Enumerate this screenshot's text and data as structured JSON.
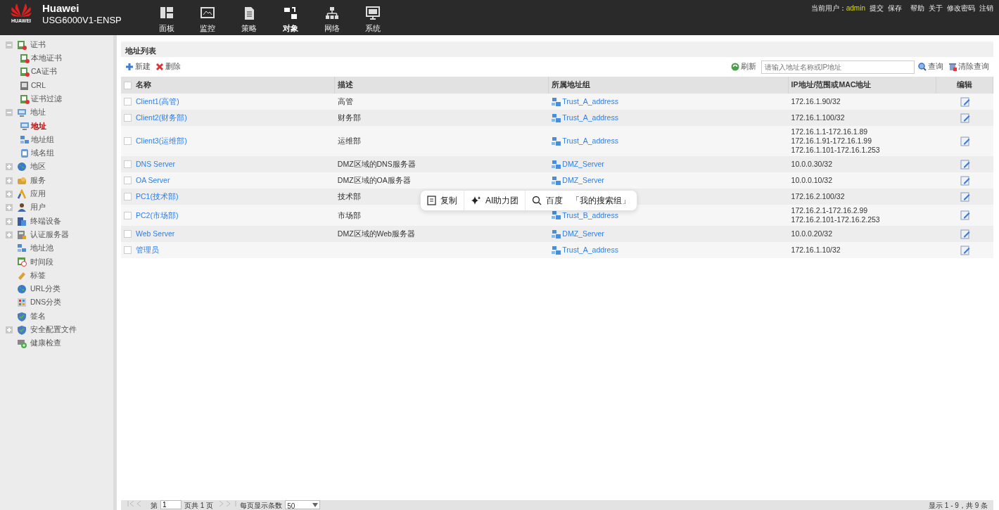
{
  "header": {
    "brand": "HUAWEI",
    "title": "Huawei",
    "model": "USG6000V1-ENSP",
    "current_user_label": "当前用户：",
    "user": "admin",
    "links": [
      "提交",
      "保存",
      "帮助",
      "关于",
      "修改密码",
      "注销"
    ]
  },
  "nav": [
    {
      "label": "面板",
      "selected": false
    },
    {
      "label": "监控",
      "selected": false
    },
    {
      "label": "策略",
      "selected": false
    },
    {
      "label": "对象",
      "selected": true
    },
    {
      "label": "网络",
      "selected": false
    },
    {
      "label": "系统",
      "selected": false
    }
  ],
  "sidebar": {
    "items": [
      {
        "label": "证书",
        "expanded": true,
        "selected": false,
        "children": [
          {
            "label": "本地证书",
            "selected": false
          },
          {
            "label": "CA证书",
            "selected": false
          },
          {
            "label": "CRL",
            "selected": false
          },
          {
            "label": "证书过滤",
            "selected": false
          }
        ]
      },
      {
        "label": "地址",
        "expanded": true,
        "selected": false,
        "children": [
          {
            "label": "地址",
            "selected": true
          },
          {
            "label": "地址组",
            "selected": false
          },
          {
            "label": "域名组",
            "selected": false
          }
        ]
      },
      {
        "label": "地区",
        "expanded": false,
        "selected": false
      },
      {
        "label": "服务",
        "expanded": false,
        "selected": false
      },
      {
        "label": "应用",
        "expanded": false,
        "selected": false
      },
      {
        "label": "用户",
        "expanded": false,
        "selected": false
      },
      {
        "label": "终端设备",
        "expanded": false,
        "selected": false
      },
      {
        "label": "认证服务器",
        "expanded": false,
        "selected": false
      },
      {
        "label": "地址池",
        "selected": false
      },
      {
        "label": "时间段",
        "selected": false
      },
      {
        "label": "标签",
        "selected": false
      },
      {
        "label": "URL分类",
        "selected": false
      },
      {
        "label": "DNS分类",
        "selected": false
      },
      {
        "label": "签名",
        "selected": false
      },
      {
        "label": "安全配置文件",
        "expanded": false,
        "selected": false
      },
      {
        "label": "健康检查",
        "selected": false
      }
    ]
  },
  "panel": {
    "title": "地址列表",
    "toolbar": {
      "new": "新建",
      "delete": "删除",
      "refresh": "刷新",
      "search": {
        "placeholder": "请输入地址名称或IP地址"
      },
      "query": "查询",
      "clear": "清除查询"
    }
  },
  "table": {
    "columns": [
      "名称",
      "描述",
      "所属地址组",
      "IP地址/范围或MAC地址",
      "编辑"
    ],
    "all_checked": false,
    "rows": [
      {
        "name": "Client1(高管)",
        "description": "高管",
        "group": "Trust_A_address",
        "addresses": [
          "172.16.1.90/32"
        ],
        "checked": false
      },
      {
        "name": "Client2(财务部)",
        "description": "财务部",
        "group": "Trust_A_address",
        "addresses": [
          "172.16.1.100/32"
        ],
        "checked": false
      },
      {
        "name": "Client3(运维部)",
        "description": "运维部",
        "group": "Trust_A_address",
        "addresses": [
          "172.16.1.1-172.16.1.89",
          "172.16.1.91-172.16.1.99",
          "172.16.1.101-172.16.1.253"
        ],
        "checked": false
      },
      {
        "name": "DNS Server",
        "description": "DMZ区域的DNS服务器",
        "group": "DMZ_Server",
        "addresses": [
          "10.0.0.30/32"
        ],
        "checked": false
      },
      {
        "name": "OA Server",
        "description": "DMZ区域的OA服务器",
        "group": "DMZ_Server",
        "addresses": [
          "10.0.0.10/32"
        ],
        "checked": false
      },
      {
        "name": "PC1(技术部)",
        "description": "技术部",
        "addresses": [
          "172.16.2.100/32"
        ],
        "checked": false
      },
      {
        "name": "PC2(市场部)",
        "description": "市场部",
        "group": "Trust_B_address",
        "addresses": [
          "172.16.2.1-172.16.2.99",
          "172.16.2.101-172.16.2.253"
        ],
        "checked": false
      },
      {
        "name": "Web Server",
        "description": "DMZ区域的Web服务器",
        "group": "DMZ_Server",
        "addresses": [
          "10.0.0.20/32"
        ],
        "checked": false
      },
      {
        "name": "管理员",
        "group": "Trust_A_address",
        "addresses": [
          "172.16.1.10/32"
        ],
        "checked": false
      }
    ]
  },
  "pager": {
    "page_prefix": "第",
    "page": "1",
    "page_suffix": "页共 1 页",
    "per_page_label": "每页显示条数",
    "per_page": "50",
    "summary": "显示 1 - 9，共 9 条"
  },
  "popup": {
    "copy": "复制",
    "ai": "AI助力团",
    "search": "百度",
    "search_group": "「我的搜索组」"
  }
}
